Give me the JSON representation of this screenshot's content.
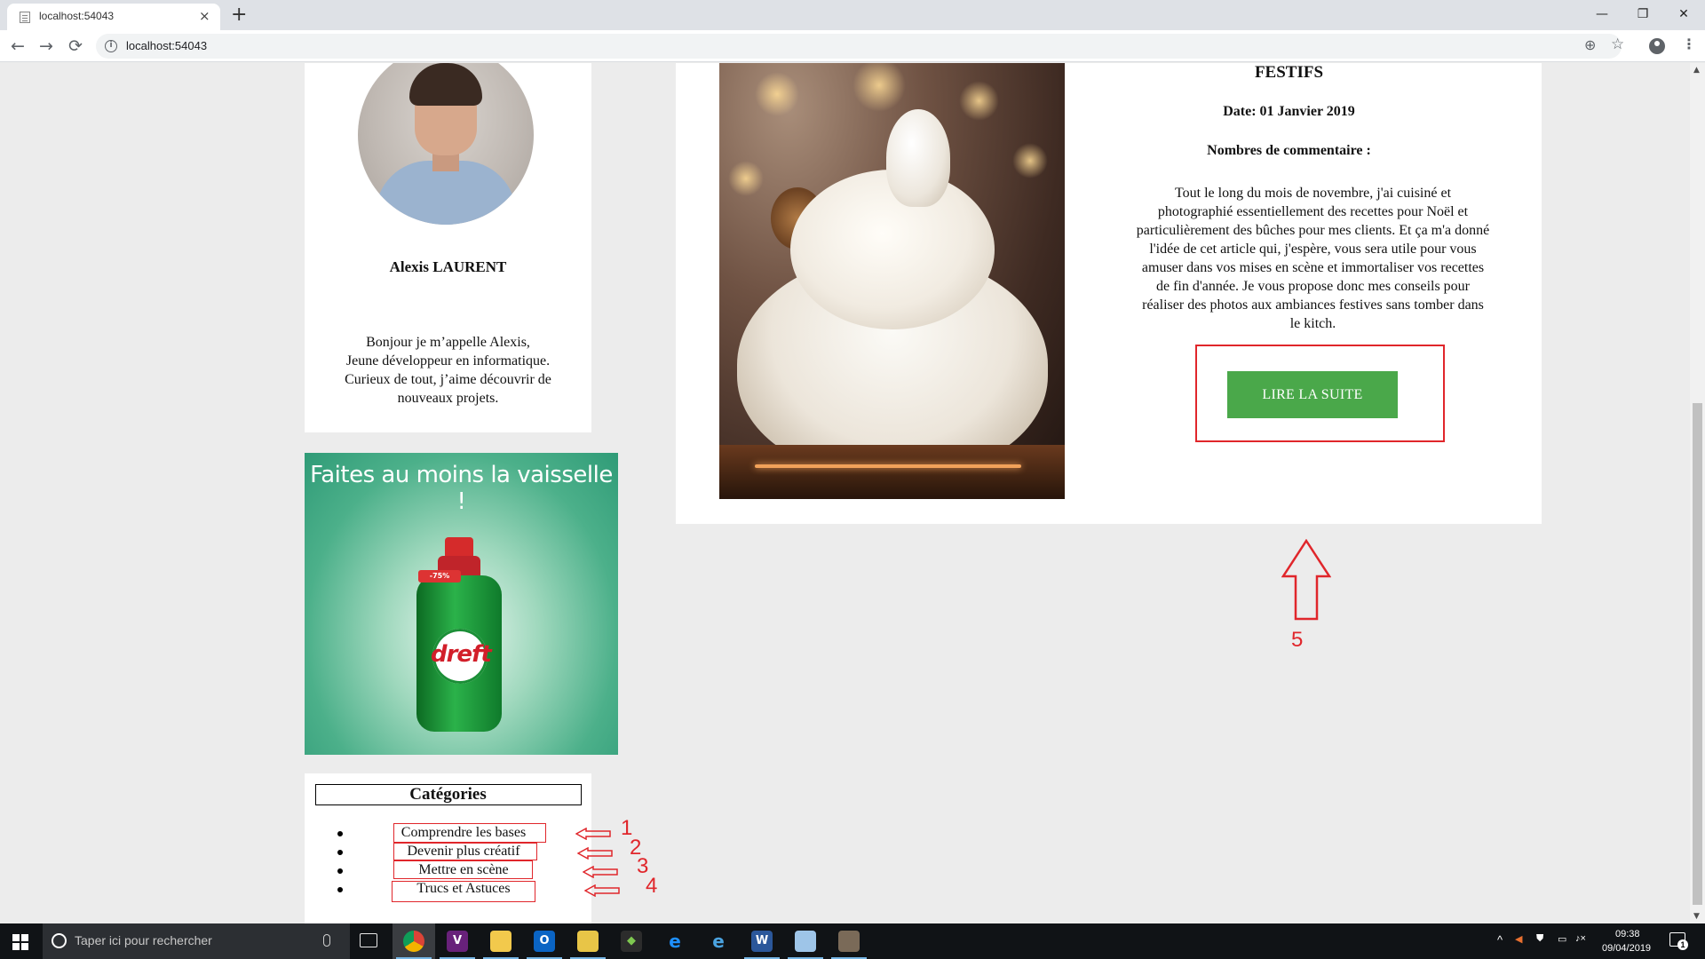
{
  "browser": {
    "tab_title": "localhost:54043",
    "tab_close": "×",
    "new_tab": "+",
    "url": "localhost:54043",
    "win_min": "—",
    "win_max": "❐",
    "win_close": "✕",
    "back": "←",
    "forward": "→",
    "reload": "⟳",
    "info": "i",
    "zoom": "⊕",
    "star": "☆",
    "menu": "⋮"
  },
  "profile": {
    "name": "Alexis LAURENT",
    "bio_lines": [
      "Bonjour je m’appelle Alexis,",
      "Jeune développeur en informatique.",
      "Curieux de tout, j’aime découvrir de",
      "nouveaux projets."
    ]
  },
  "ad": {
    "headline": "Faites au moins la vaisselle !",
    "brand": "dreft",
    "badge": "-75%"
  },
  "categories": {
    "title": "Catégories",
    "items": [
      {
        "label": "Comprendre les bases",
        "annotation": "1"
      },
      {
        "label": "Devenir plus créatif",
        "annotation": "2"
      },
      {
        "label": "Mettre en scène",
        "annotation": "3"
      },
      {
        "label": "Trucs et Astuces",
        "annotation": "4"
      }
    ]
  },
  "article": {
    "title": "FESTIFS",
    "date": "Date: 01 Janvier 2019",
    "comments": "Nombres de commentaire :",
    "body_lines": [
      "Tout le long du mois de novembre, j'ai cuisiné et",
      "photographié essentiellement des recettes pour Noël et",
      "particulièrement des bûches pour mes clients. Et ça m'a donné",
      "l'idée de cet article qui, j'espère, vous sera utile pour vous",
      "amuser dans vos mises en scène et immortaliser vos recettes",
      "de fin d'année. Je vous propose donc mes conseils pour",
      "réaliser des photos aux ambiances festives sans tomber dans",
      "le kitch."
    ],
    "read_more": "LIRE LA SUITE",
    "annotation": "5"
  },
  "taskbar": {
    "search_placeholder": "Taper ici pour rechercher",
    "time": "09:38",
    "date": "09/04/2019",
    "notifications": "1",
    "apps": [
      "chrome-icon",
      "visual-studio-icon",
      "file-explorer-icon",
      "outlook-icon",
      "notepad-icon",
      "git-icon",
      "edge-icon",
      "internet-explorer-icon",
      "word-icon",
      "paint-icon",
      "gimp-icon"
    ]
  },
  "colors": {
    "button_green": "#4aa84a",
    "annotation_red": "#e0262b",
    "page_bg": "#ececec"
  }
}
